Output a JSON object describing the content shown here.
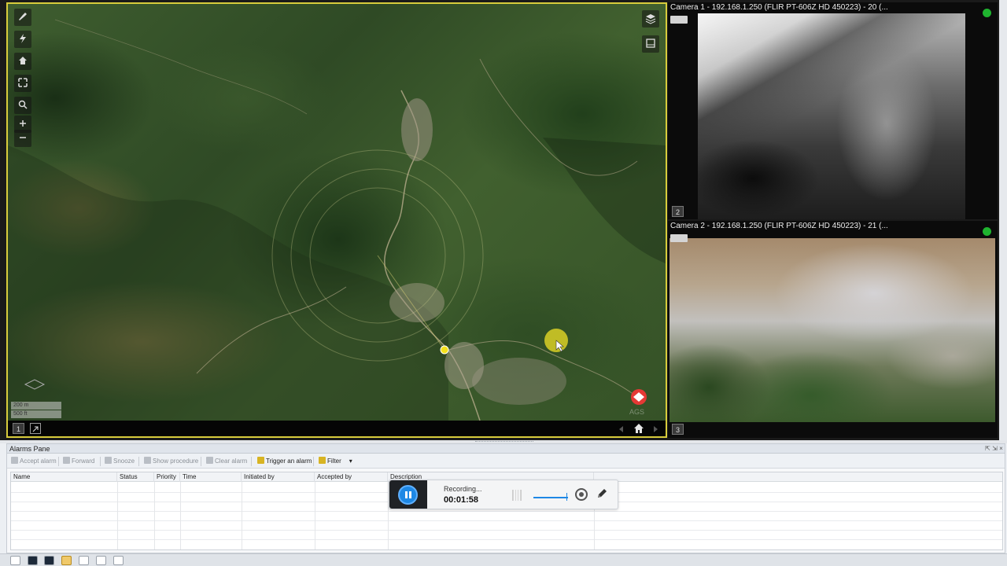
{
  "map": {
    "tile_number": "1",
    "scale": [
      "200 m",
      "500 ft"
    ],
    "toolbar_icons": [
      "wrench-icon",
      "lightning-icon",
      "home-icon",
      "fullscreen-icon",
      "search-icon",
      "zoom-in-icon",
      "zoom-out-icon"
    ],
    "right_icons": [
      "layers-icon",
      "frame-icon"
    ],
    "footer_icons": [
      "back-arrow-icon",
      "home-icon",
      "forward-arrow-icon"
    ]
  },
  "cameras": [
    {
      "title": "Camera 1 - 192.168.1.250 (FLIR PT-606Z HD 450223) - 20 (...",
      "tile_number": "2",
      "status_color": "#1fb42f"
    },
    {
      "title": "Camera 2 - 192.168.1.250 (FLIR PT-606Z HD 450223) - 21 (...",
      "tile_number": "3",
      "status_color": "#1fb42f"
    }
  ],
  "alarms": {
    "pane_title": "Alarms Pane",
    "toolbar": [
      {
        "label": "Accept alarm",
        "enabled": false
      },
      {
        "label": "Forward",
        "enabled": false
      },
      {
        "label": "Snooze",
        "enabled": false
      },
      {
        "label": "Show procedure",
        "enabled": false
      },
      {
        "label": "Clear alarm",
        "enabled": false
      },
      {
        "label": "Trigger an alarm",
        "enabled": true
      },
      {
        "label": "Filter",
        "enabled": true
      }
    ],
    "columns": [
      "Name",
      "Status",
      "Priority",
      "Time",
      "Initiated by",
      "Accepted by",
      "Description"
    ],
    "rows": []
  },
  "recorder": {
    "status": "Recording...",
    "elapsed": "00:01:58"
  }
}
